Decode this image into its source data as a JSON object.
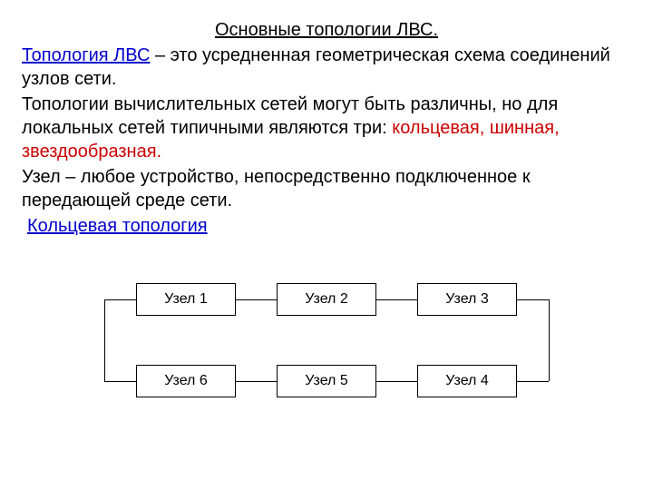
{
  "title": "Основные топологии ЛВС.",
  "para1_link": "Топология ЛВС",
  "para1_rest": " – это усредненная геометрическая схема соединений узлов сети.",
  "para2_a": "Топологии вычислительных сетей могут быть различны, но для локальных сетей типичными являются три: ",
  "para2_red": "кольцевая, шинная, звездообразная.",
  "para3": "Узел – любое устройство, непосредственно подключенное к передающей среде сети.",
  "section_link": "Кольцевая топология",
  "nodes": {
    "n1": "Узел 1",
    "n2": "Узел 2",
    "n3": "Узел 3",
    "n4": "Узел 4",
    "n5": "Узел 5",
    "n6": "Узел 6"
  }
}
